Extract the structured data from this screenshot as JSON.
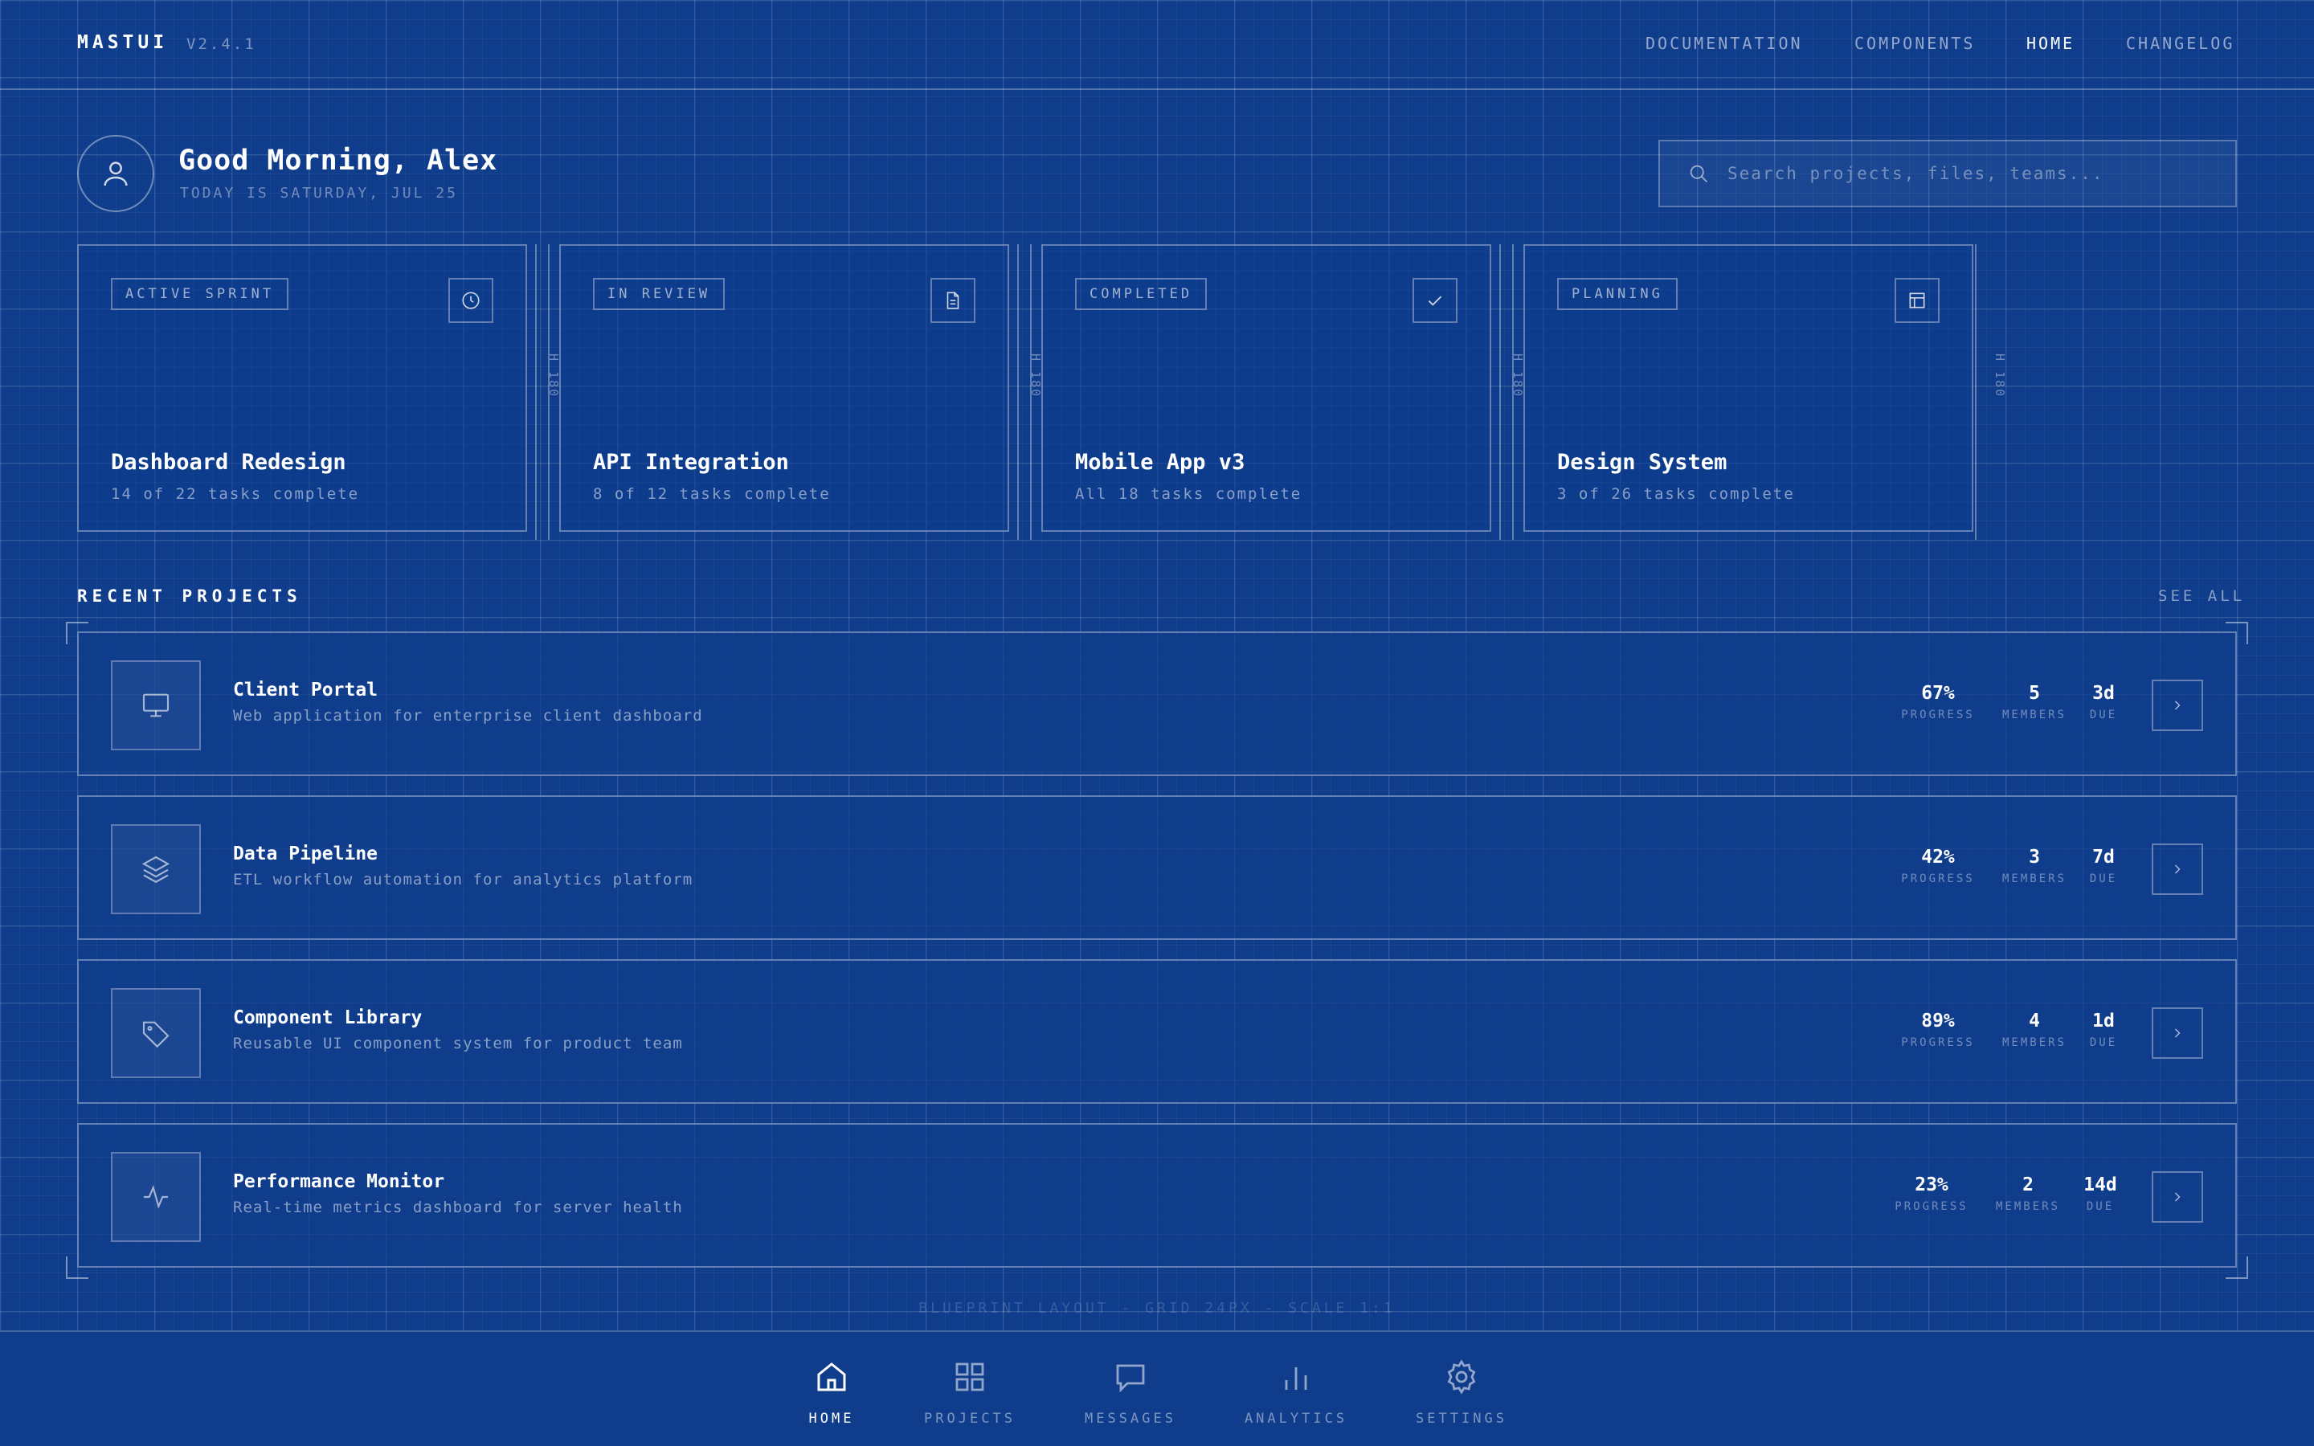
{
  "header": {
    "brand": "MASTUI",
    "version": "V2.4.1",
    "nav": [
      {
        "label": "DOCUMENTATION",
        "active": false
      },
      {
        "label": "COMPONENTS",
        "active": false
      },
      {
        "label": "HOME",
        "active": true
      },
      {
        "label": "CHANGELOG",
        "active": false
      }
    ]
  },
  "greeting": {
    "title": "Good Morning, Alex",
    "date": "TODAY IS SATURDAY, JUL 25",
    "avatar_icon": "user-icon"
  },
  "search": {
    "placeholder": "Search projects, files, teams...",
    "value": "",
    "icon": "search-icon"
  },
  "status_cards": [
    {
      "badge": "ACTIVE SPRINT",
      "icon": "clock-icon",
      "title": "Dashboard Redesign",
      "subtitle": "14 of 22 tasks complete"
    },
    {
      "badge": "IN REVIEW",
      "icon": "document-icon",
      "title": "API Integration",
      "subtitle": "8 of 12 tasks complete"
    },
    {
      "badge": "COMPLETED",
      "icon": "check-icon",
      "title": "Mobile App v3",
      "subtitle": "All 18 tasks complete"
    },
    {
      "badge": "PLANNING",
      "icon": "layout-icon",
      "title": "Design System",
      "subtitle": "3 of 26 tasks complete"
    }
  ],
  "dimension_label": "H 180",
  "recent": {
    "heading": "RECENT PROJECTS",
    "see_all": "SEE ALL",
    "stat_labels": {
      "progress": "PROGRESS",
      "members": "MEMBERS",
      "due": "DUE"
    },
    "projects": [
      {
        "icon": "monitor-icon",
        "name": "Client Portal",
        "description": "Web application for enterprise client dashboard",
        "progress": "67%",
        "members": "5",
        "due": "3d"
      },
      {
        "icon": "layers-icon",
        "name": "Data Pipeline",
        "description": "ETL workflow automation for analytics platform",
        "progress": "42%",
        "members": "3",
        "due": "7d"
      },
      {
        "icon": "tag-icon",
        "name": "Component Library",
        "description": "Reusable UI component system for product team",
        "progress": "89%",
        "members": "4",
        "due": "1d"
      },
      {
        "icon": "activity-icon",
        "name": "Performance Monitor",
        "description": "Real-time metrics dashboard for server health",
        "progress": "23%",
        "members": "2",
        "due": "14d"
      }
    ]
  },
  "footnote": "BLUEPRINT LAYOUT - GRID 24PX - SCALE 1:1",
  "bottom_nav": [
    {
      "label": "HOME",
      "icon": "home-icon",
      "active": true
    },
    {
      "label": "PROJECTS",
      "icon": "grid-icon",
      "active": false
    },
    {
      "label": "MESSAGES",
      "icon": "message-icon",
      "active": false
    },
    {
      "label": "ANALYTICS",
      "icon": "bar-chart-icon",
      "active": false
    },
    {
      "label": "SETTINGS",
      "icon": "gear-icon",
      "active": false
    }
  ],
  "colors": {
    "background": "#0f3d8c",
    "line": "#ffffff",
    "accent_text": "#ffffff"
  }
}
